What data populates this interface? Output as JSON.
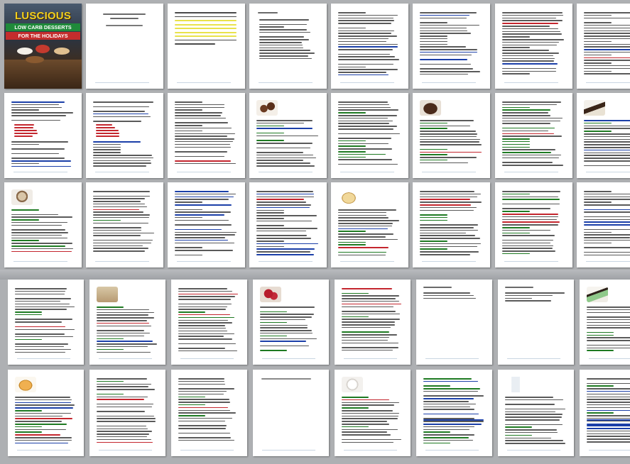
{
  "viewer": {
    "title": "",
    "background_color": "#aeb0b3"
  },
  "cover": {
    "title": "LUSCIOUS",
    "subtitle_line1": "LOW CARB DESSERTS",
    "subtitle_line2": "FOR THE HOLIDAYS"
  },
  "colors": {
    "text": "#2a2a2a",
    "link": "#1b3fa8",
    "highlight_yellow": "#e9e24a",
    "heading_green": "#1e7a22",
    "list_red": "#c4262e"
  },
  "pages": [
    {
      "kind": "cover"
    },
    {
      "kind": "title"
    },
    {
      "kind": "highlight"
    },
    {
      "kind": "toc"
    },
    {
      "kind": "text"
    },
    {
      "kind": "text"
    },
    {
      "kind": "text"
    },
    {
      "kind": "text"
    },
    {
      "kind": "text-list"
    },
    {
      "kind": "text-list"
    },
    {
      "kind": "text"
    },
    {
      "kind": "image",
      "icon": "chocolate-truffle-photo"
    },
    {
      "kind": "recipe"
    },
    {
      "kind": "image",
      "icon": "cookie-photo"
    },
    {
      "kind": "recipe"
    },
    {
      "kind": "image",
      "icon": "cake-slice-photo"
    },
    {
      "kind": "image",
      "icon": "coffee-cup-photo"
    },
    {
      "kind": "recipe"
    },
    {
      "kind": "text"
    },
    {
      "kind": "text"
    },
    {
      "kind": "image",
      "icon": "cheesecake-photo"
    },
    {
      "kind": "recipe"
    },
    {
      "kind": "recipe"
    },
    {
      "kind": "text"
    },
    {
      "kind": "recipe"
    },
    {
      "kind": "image",
      "icon": "bar-dessert-photo"
    },
    {
      "kind": "recipe"
    },
    {
      "kind": "image",
      "icon": "berry-dessert-photo"
    },
    {
      "kind": "recipe"
    },
    {
      "kind": "short"
    },
    {
      "kind": "short"
    },
    {
      "kind": "image",
      "icon": "mint-pie-photo"
    },
    {
      "kind": "image",
      "icon": "custard-photo"
    },
    {
      "kind": "recipe"
    },
    {
      "kind": "recipe"
    },
    {
      "kind": "blank"
    },
    {
      "kind": "image",
      "icon": "meringue-photo"
    },
    {
      "kind": "links"
    },
    {
      "kind": "image",
      "icon": "milk-glass-photo"
    },
    {
      "kind": "links"
    }
  ]
}
